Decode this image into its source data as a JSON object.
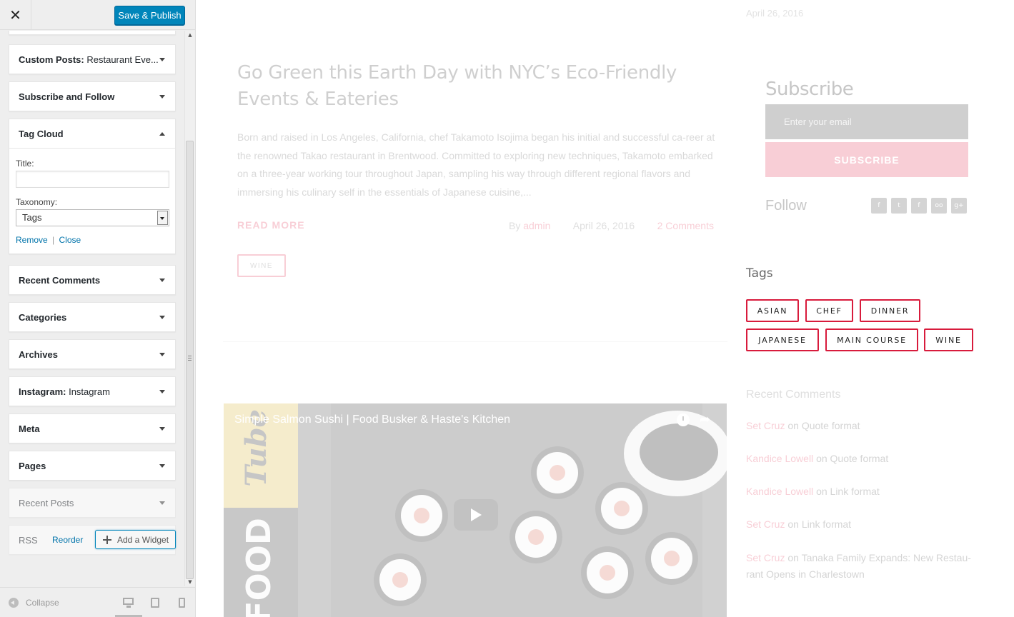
{
  "customizer": {
    "close_icon": "close-icon",
    "publish_label": "Save & Publish",
    "widgets": {
      "custom_posts": {
        "title": "Custom Posts:",
        "subtitle": "Restaurant Eve..."
      },
      "subscribe_follow": {
        "title": "Subscribe and Follow"
      },
      "tag_cloud": {
        "title": "Tag Cloud",
        "title_label": "Title:",
        "title_value": "",
        "taxonomy_label": "Taxonomy:",
        "taxonomy_value": "Tags",
        "remove_label": "Remove",
        "separator": "|",
        "close_label": "Close"
      },
      "recent_comments": {
        "title": "Recent Comments"
      },
      "categories": {
        "title": "Categories"
      },
      "archives": {
        "title": "Archives"
      },
      "instagram": {
        "title": "Instagram:",
        "subtitle": "Instagram"
      },
      "meta": {
        "title": "Meta"
      },
      "pages": {
        "title": "Pages"
      },
      "recent_posts": {
        "title": "Recent Posts"
      },
      "rss": {
        "title": "RSS"
      }
    },
    "reorder_label": "Reorder",
    "add_widget_label": "Add a Widget",
    "collapse_label": "Collapse",
    "devices": [
      "desktop-icon",
      "tablet-icon",
      "mobile-icon"
    ]
  },
  "preview": {
    "top_date": "April 26, 2016",
    "post": {
      "title": "Go Green this Earth Day with NYC’s Eco-Friendly Events & Eateries",
      "excerpt": "Born and raised in Los Angeles, California, chef Takamoto Isojima began his initial and successful ca-reer at the renowned Takao restaurant in Brentwood. Committed to exploring new techniques, Takamoto embarked on a three-year working tour throughout Japan, sampling his way through different regional flavors and immersing his culinary self in the essentials of Japanese cuisine,...",
      "read_more": "READ MORE",
      "by": "By",
      "author": "admin",
      "date": "April 26, 2016",
      "comments": "2 Comments",
      "tag": "WINE"
    },
    "video": {
      "title": "Simple Salmon Sushi | Food Busker & Haste's Kitchen",
      "side_text": "FOOD",
      "logo_text": "Tube"
    },
    "sidebar": {
      "subscribe_title": "Subscribe",
      "email_placeholder": "Enter your email",
      "subscribe_button": "SUBSCRIBE",
      "follow_title": "Follow",
      "social_icons": [
        "foursquare-icon",
        "twitter-icon",
        "facebook-icon",
        "tripadvisor-icon",
        "google-plus-icon"
      ],
      "social_glyphs": [
        "f",
        "t",
        "f",
        "oo",
        "g+"
      ],
      "tags_title": "Tags",
      "tags": [
        "ASIAN",
        "CHEF",
        "DINNER",
        "JAPANESE",
        "MAIN COURSE",
        "WINE"
      ],
      "recent_comments_title": "Recent Comments",
      "recent_comments": [
        {
          "author": "Set Cruz",
          "on": "on",
          "post": "Quote format"
        },
        {
          "author": "Kandice Lowell",
          "on": "on",
          "post": "Quote format"
        },
        {
          "author": "Kandice Lowell",
          "on": "on",
          "post": "Link format"
        },
        {
          "author": "Set Cruz",
          "on": "on",
          "post": "Link format"
        },
        {
          "author": "Set Cruz",
          "on": "on",
          "post": "Tanaka Family Expands: New Restau-rant Opens in Charlestown"
        }
      ]
    }
  },
  "colors": {
    "accent": "#e5506b",
    "tag_border": "#d81b3c",
    "wp_blue": "#0085ba",
    "link_blue": "#0073aa"
  }
}
